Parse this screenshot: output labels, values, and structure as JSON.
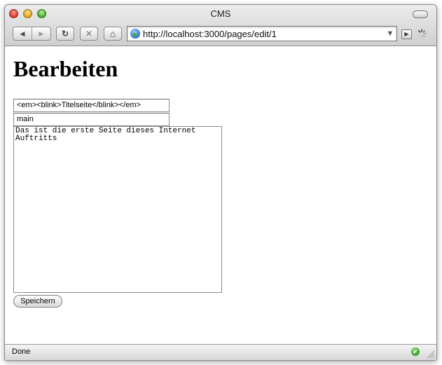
{
  "window": {
    "title": "CMS"
  },
  "toolbar": {
    "back_glyph": "◀",
    "forward_glyph": "▶",
    "reload_glyph": "↻",
    "stop_glyph": "✕",
    "home_glyph": "⌂",
    "url": "http://localhost:3000/pages/edit/1",
    "dropdown_glyph": "▼",
    "go_glyph": "▶"
  },
  "page": {
    "heading": "Bearbeiten",
    "title_value": "<em><blink>Titelseite</blink></em>",
    "name_value": "main",
    "body_value": "Das ist die erste Seite dieses Internet\nAuftritts",
    "save_label": "Speichern"
  },
  "status": {
    "text": "Done",
    "ok_glyph": "✔"
  },
  "colors": {
    "close": "#d7382a",
    "minimize": "#e0a21c",
    "maximize": "#46a626",
    "status_ok": "#2d9b1d"
  },
  "icons": [
    "close-icon",
    "minimize-icon",
    "maximize-icon",
    "back-icon",
    "forward-icon",
    "reload-icon",
    "stop-icon",
    "home-icon",
    "globe-icon",
    "dropdown-icon",
    "go-icon",
    "spinner-icon",
    "checkmark-icon",
    "resize-grip-icon"
  ]
}
